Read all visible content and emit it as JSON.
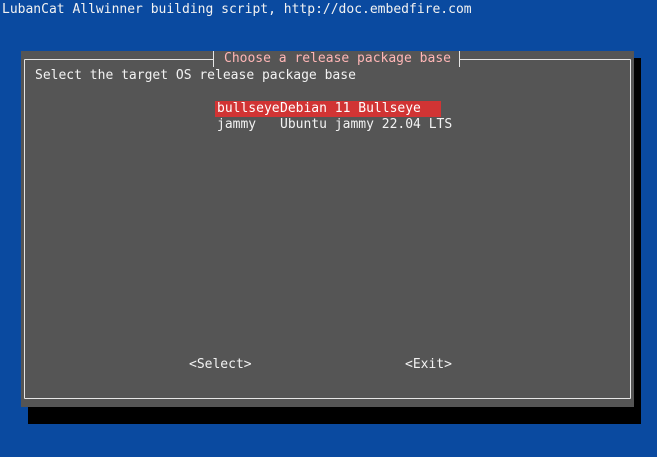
{
  "backtitle": "LubanCat Allwinner building script, http://doc.embedfire.com",
  "dialog": {
    "title": "Choose a release package base",
    "prompt": "Select the target OS release package base",
    "menu_items": [
      {
        "tag": "bullseye",
        "description": "Debian 11 Bullseye",
        "selected": true
      },
      {
        "tag": "jammy",
        "description": "Ubuntu jammy 22.04 LTS",
        "selected": false
      }
    ],
    "buttons": {
      "select_label": "<Select>",
      "exit_label": "<Exit>"
    }
  },
  "colors": {
    "background": "#0a4aa0",
    "dialog": "#555555",
    "highlight": "#d13434",
    "title_text": "#ffb6b6"
  }
}
